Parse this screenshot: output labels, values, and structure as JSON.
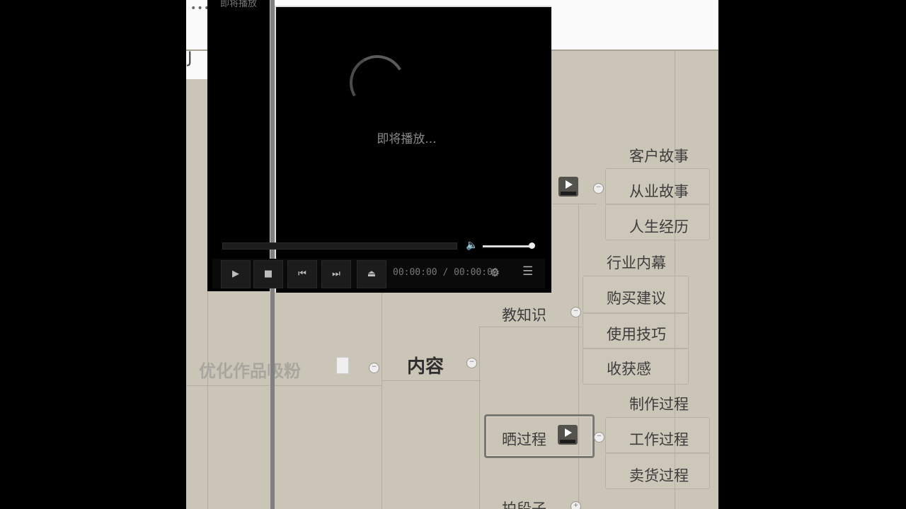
{
  "topbar": {
    "dots": "•••"
  },
  "subbar": {
    "char": "J"
  },
  "mindmap": {
    "root": "优化作品吸粉",
    "center": "内容",
    "branches": {
      "story_children": [
        "客户故事",
        "从业故事",
        "人生经历"
      ],
      "knowledge": "教知识",
      "knowledge_children": [
        "行业内幕",
        "购买建议",
        "使用技巧",
        "收获感"
      ],
      "process": "晒过程",
      "process_children": [
        "制作过程",
        "工作过程",
        "卖货过程"
      ],
      "bottom": "拍段子"
    }
  },
  "player": {
    "title": "即将播放",
    "loading_text": "即将播放...",
    "time_current": "00:00:00",
    "time_separator": "/",
    "time_total": "00:00:00",
    "volume": 0.95
  }
}
